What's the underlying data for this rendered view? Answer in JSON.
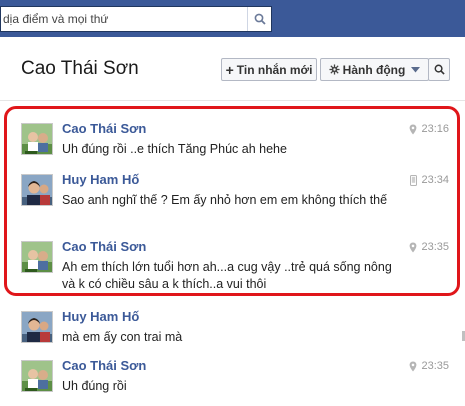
{
  "search": {
    "value": "dịa điểm và mọi thứ"
  },
  "conversation": {
    "title": "Cao Thái Sơn"
  },
  "toolbar": {
    "new_message_label": "Tin nhắn mới",
    "actions_label": "Hành động"
  },
  "messages": [
    {
      "sender": "Cao Thái Sơn",
      "text": "Uh đúng rồi ..e thích Tăng Phúc ah hehe",
      "time": "23:16",
      "source_icon": "location-pin-icon"
    },
    {
      "sender": "Huy Ham Hố",
      "text": "Sao anh nghĩ thế ? Em ấy nhỏ hơn em em không thích thế",
      "time": "23:34",
      "source_icon": "mobile-phone-icon"
    },
    {
      "sender": "Cao Thái Sơn",
      "text": "Ah em thích lớn tuổi hơn ah...a cug vậy ..trẻ quá sống nông và k có chiều sâu a k thích..a vui thôi",
      "time": "23:35",
      "source_icon": "location-pin-icon"
    },
    {
      "sender": "Huy Ham Hố",
      "text": "mà em ấy con trai mà",
      "time": "",
      "source_icon": ""
    },
    {
      "sender": "Cao Thái Sơn",
      "text": "Uh đúng rồi",
      "time": "23:35",
      "source_icon": "location-pin-icon"
    }
  ],
  "colors": {
    "topbar": "#3b5998",
    "name_link": "#3b5998",
    "highlight": "#e0161a",
    "meta_gray": "#999999"
  }
}
